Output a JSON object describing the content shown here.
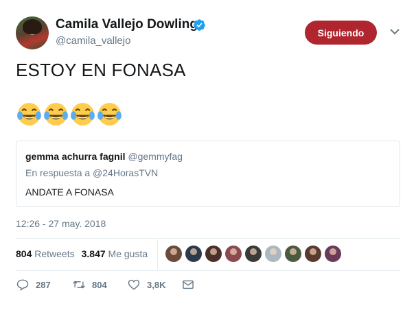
{
  "author": {
    "name": "Camila Vallejo Dowling",
    "handle": "@camila_vallejo",
    "verified_icon": "verified-badge-icon"
  },
  "follow_button": {
    "label": "Siguiendo",
    "color": "#b0262f"
  },
  "tweet": {
    "text": "ESTOY EN FONASA",
    "emojis": [
      "😂",
      "😂",
      "😂",
      "😂"
    ]
  },
  "quoted_tweet": {
    "author_name": "gemma achurra fagnil",
    "author_handle": "@gemmyfag",
    "reply_to": "En respuesta a @24HorasTVN",
    "text": "ANDATE A FONASA"
  },
  "timestamp": "12:26 - 27 may. 2018",
  "stats": {
    "retweets_count": "804",
    "retweets_label": "Retweets",
    "likes_count": "3.847",
    "likes_label": "Me gusta"
  },
  "likers": [
    {
      "color": "#6b4a3a"
    },
    {
      "color": "#2b3a4a"
    },
    {
      "color": "#4a2f2a"
    },
    {
      "color": "#8a4a50"
    },
    {
      "color": "#3a3a3a"
    },
    {
      "color": "#aab8c2"
    },
    {
      "color": "#4a5a40"
    },
    {
      "color": "#5a3a30"
    },
    {
      "color": "#6a3a5a"
    }
  ],
  "actions": {
    "reply_count": "287",
    "retweet_count": "804",
    "like_count": "3,8K"
  },
  "colors": {
    "text_primary": "#14171a",
    "text_secondary": "#657786",
    "divider": "#e6ecf0",
    "verified_blue": "#1da1f2"
  }
}
